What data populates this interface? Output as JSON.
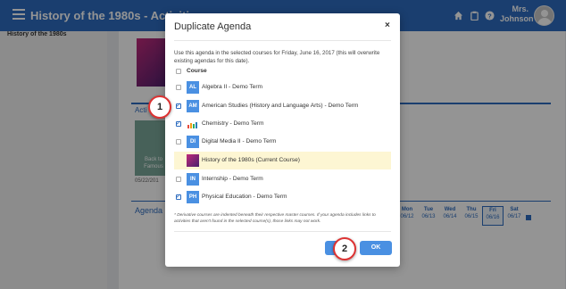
{
  "header": {
    "title": "History of the 1980s - Activities",
    "user_name": "Mrs. Johnson"
  },
  "left_panel": {
    "title": "History of the 1980s"
  },
  "background": {
    "activities_label": "Acti",
    "card_text": "Back to Famous",
    "card_date": "05/22/201",
    "agenda_label": "Agenda",
    "days": [
      {
        "name": "Mon",
        "date": "06/12"
      },
      {
        "name": "Tue",
        "date": "06/13"
      },
      {
        "name": "Wed",
        "date": "06/14"
      },
      {
        "name": "Thu",
        "date": "06/15"
      },
      {
        "name": "Fri",
        "date": "06/16"
      },
      {
        "name": "Sat",
        "date": "06/17"
      }
    ]
  },
  "modal": {
    "title": "Duplicate Agenda",
    "close": "×",
    "description": "Use this agenda in the selected courses for Friday, June 16, 2017 (this will overwrite existing agendas for this date).",
    "column_header": "Course",
    "courses": [
      {
        "badge": "AL",
        "label": "Algebra II - Demo Term",
        "checked": false
      },
      {
        "badge": "AM",
        "label": "American Studies (History and Language Arts) - Demo Term",
        "checked": true
      },
      {
        "badge": "",
        "label": "Chemistry - Demo Term",
        "checked": true
      },
      {
        "badge": "DI",
        "label": "Digital Media II - Demo Term",
        "checked": false
      },
      {
        "badge": "",
        "label": "History of the 1980s  (Current Course)",
        "checked": false
      },
      {
        "badge": "IN",
        "label": "Internship - Demo Term",
        "checked": false
      },
      {
        "badge": "PH",
        "label": "Physical Education - Demo Term",
        "checked": true
      }
    ],
    "note": "* Derivative courses are indented beneath their respective master courses. If your agenda includes links to activities that aren't found in the selected course(s), those links may not work.",
    "ok_label": "OK"
  },
  "callouts": {
    "step1": "1",
    "step2": "2"
  },
  "colors": {
    "accent": "#2d6cbf",
    "button": "#4a90e2",
    "highlight": "#fdf6d3",
    "callout_border": "#dd3333"
  }
}
